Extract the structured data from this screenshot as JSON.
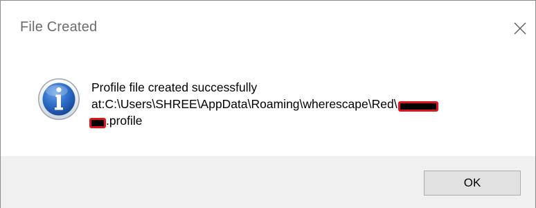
{
  "dialog": {
    "title": "File Created",
    "message_line1": "Profile file created successfully",
    "message_line2": "at:C:\\Users\\SHREE\\AppData\\Roaming\\wherescape\\Red\\",
    "message_line3_suffix": ".profile",
    "ok_label": "OK",
    "icon": "info-icon",
    "close_icon": "close-icon"
  },
  "colors": {
    "footer_background": "#f0f0f0",
    "redaction_outline": "#e0151b",
    "redaction_fill": "#000000",
    "icon_blue": "#1f5fb8"
  }
}
